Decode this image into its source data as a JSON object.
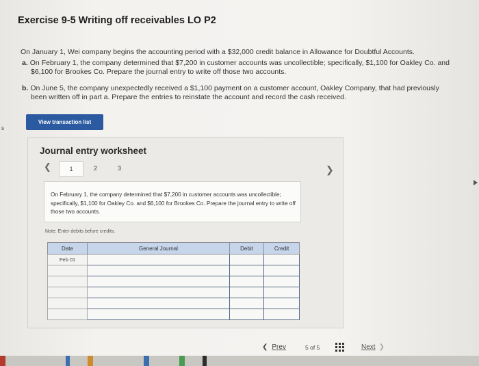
{
  "exercise": {
    "title": "Exercise 9-5 Writing off receivables LO P2",
    "intro": "On January 1, Wei company begins the accounting period with a $32,000 credit balance in Allowance for Doubtful Accounts.",
    "item_a_letter": "a.",
    "item_a_line1": "On February 1, the company determined that $7,200 in customer accounts was uncollectible; specifically, $1,100 for Oakley Co. and",
    "item_a_line2": "$6,100 for Brookes Co. Prepare the journal entry to write off those two accounts.",
    "item_b_letter": "b.",
    "item_b_line1": "On June 5, the company unexpectedly received a $1,100 payment on a customer account, Oakley Company, that had previously",
    "item_b_line2": "been written off in part a. Prepare the entries to reinstate the account and record the cash received."
  },
  "toolbar": {
    "view_transaction_list": "View transaction list"
  },
  "worksheet": {
    "title": "Journal entry worksheet",
    "pages": [
      "1",
      "2",
      "3"
    ],
    "description": "On February 1, the company determined that $7,200 in customer accounts was uncollectible; specifically, $1,100 for Oakley Co. and $6,100 for Brookes Co. Prepare the journal entry to write off those two accounts.",
    "note": "Note: Enter debits before credits.",
    "table": {
      "headers": {
        "date": "Date",
        "general_journal": "General Journal",
        "debit": "Debit",
        "credit": "Credit"
      },
      "first_date": "Feb 01"
    }
  },
  "navigation": {
    "prev_label": "Prev",
    "page_current": "5",
    "page_of": "of",
    "page_total": "5",
    "next_label": "Next"
  },
  "icons": {
    "prev_page": "chevron-left-icon",
    "next_page": "chevron-right-icon",
    "grid": "grid-icon"
  },
  "colors": {
    "primary_button": "#2c5aa0",
    "table_header": "#c6d5ea",
    "input_border": "#566a85"
  }
}
